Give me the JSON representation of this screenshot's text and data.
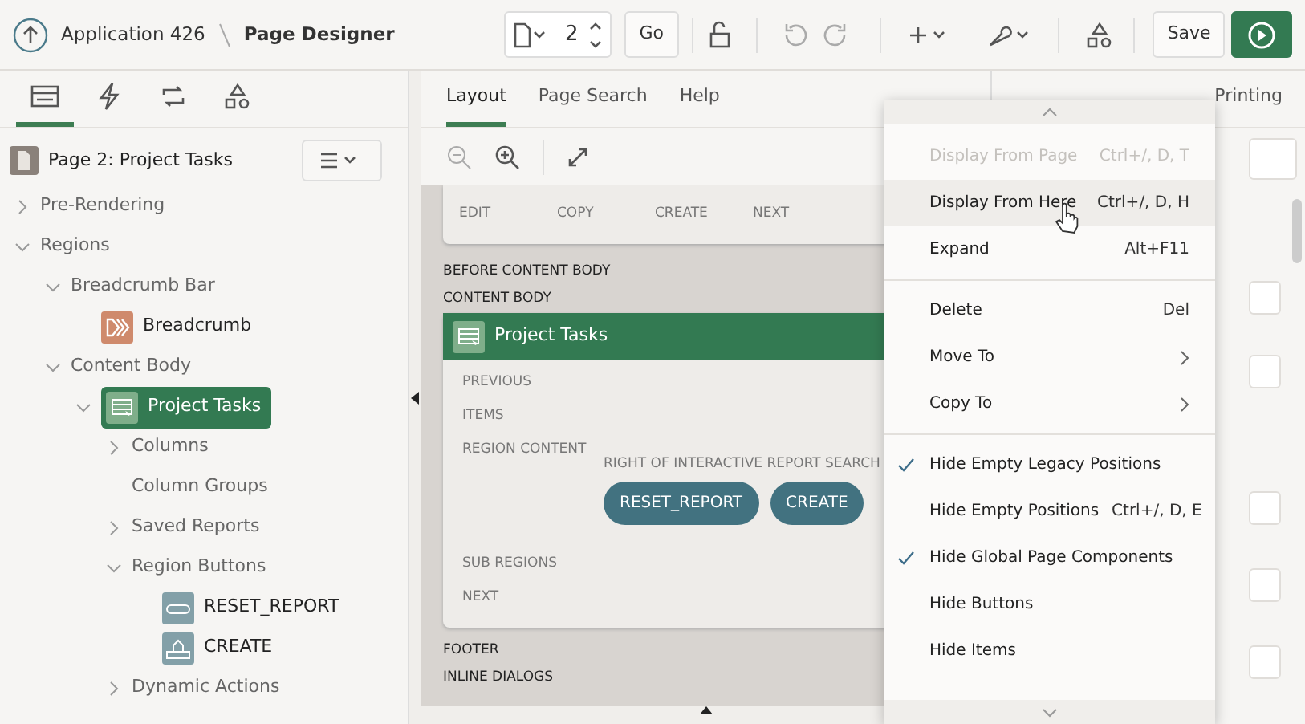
{
  "header": {
    "app_label": "Application 426",
    "page_label": "Page Designer",
    "page_number": "2",
    "go_button": "Go",
    "save_button": "Save"
  },
  "left_tabs": [
    {
      "kind": "tree",
      "selected": true
    },
    {
      "kind": "bolt",
      "selected": false
    },
    {
      "kind": "sync",
      "selected": false
    },
    {
      "kind": "shapes",
      "selected": false
    }
  ],
  "page_title": "Page 2: Project Tasks",
  "tree": [
    {
      "label": "Pre-Rendering",
      "expanded": false,
      "selected": false
    },
    {
      "label": "Regions",
      "expanded": true,
      "selected": false,
      "children": [
        {
          "label": "Breadcrumb Bar",
          "expanded": true,
          "selected": false,
          "children": [
            {
              "label": "Breadcrumb",
              "kind": "breadcrumb",
              "selected": false
            }
          ]
        },
        {
          "label": "Content Body",
          "expanded": true,
          "selected": false,
          "children": [
            {
              "label": "Project Tasks",
              "kind": "report",
              "expanded": true,
              "selected": true,
              "children": [
                {
                  "label": "Columns",
                  "expanded": false,
                  "selected": false
                },
                {
                  "label": "Column Groups",
                  "selected": false
                },
                {
                  "label": "Saved Reports",
                  "expanded": false,
                  "selected": false
                },
                {
                  "label": "Region Buttons",
                  "expanded": true,
                  "selected": false,
                  "children": [
                    {
                      "label": "RESET_REPORT",
                      "kind": "button",
                      "selected": false
                    },
                    {
                      "label": "CREATE",
                      "kind": "create",
                      "selected": false
                    }
                  ]
                },
                {
                  "label": "Dynamic Actions",
                  "expanded": false,
                  "selected": false
                }
              ]
            }
          ]
        }
      ]
    }
  ],
  "center_tabs": [
    {
      "label": "Layout",
      "selected": true
    },
    {
      "label": "Page Search",
      "selected": false
    },
    {
      "label": "Help",
      "selected": false
    }
  ],
  "layout": {
    "top_slots": [
      "EDIT",
      "COPY",
      "CREATE",
      "NEXT"
    ],
    "positions_before": [
      "BEFORE CONTENT BODY",
      "CONTENT BODY"
    ],
    "region": {
      "title": "Project Tasks",
      "slots": [
        "PREVIOUS",
        "ITEMS",
        "REGION CONTENT"
      ],
      "button_position": "RIGHT OF INTERACTIVE REPORT SEARCH",
      "buttons": [
        "RESET_REPORT",
        "CREATE"
      ],
      "slots_after": [
        "SUB REGIONS",
        "NEXT"
      ]
    },
    "positions_after": [
      "FOOTER",
      "INLINE DIALOGS"
    ]
  },
  "right_tabs": [
    {
      "label": "Printing",
      "selected": false
    }
  ],
  "context_menu": [
    {
      "kind": "item",
      "label": "Display From Page",
      "shortcut": "Ctrl+/, D, T",
      "disabled": true,
      "checked": false,
      "hovered": false
    },
    {
      "kind": "item",
      "label": "Display From Here",
      "shortcut": "Ctrl+/, D, H",
      "disabled": false,
      "checked": false,
      "hovered": true
    },
    {
      "kind": "item",
      "label": "Expand",
      "shortcut": "Alt+F11",
      "disabled": false,
      "checked": false,
      "hovered": false
    },
    {
      "kind": "separator"
    },
    {
      "kind": "item",
      "label": "Delete",
      "shortcut": "Del",
      "disabled": false,
      "checked": false,
      "hovered": false
    },
    {
      "kind": "submenu",
      "label": "Move To",
      "disabled": false,
      "checked": false,
      "hovered": false
    },
    {
      "kind": "submenu",
      "label": "Copy To",
      "disabled": false,
      "checked": false,
      "hovered": false
    },
    {
      "kind": "separator"
    },
    {
      "kind": "item",
      "label": "Hide Empty Legacy Positions",
      "disabled": false,
      "checked": true,
      "hovered": false
    },
    {
      "kind": "item",
      "label": "Hide Empty Positions",
      "shortcut": "Ctrl+/, D, E",
      "disabled": false,
      "checked": false,
      "hovered": false
    },
    {
      "kind": "item",
      "label": "Hide Global Page Components",
      "disabled": false,
      "checked": true,
      "hovered": false
    },
    {
      "kind": "item",
      "label": "Hide Buttons",
      "disabled": false,
      "checked": false,
      "hovered": false
    },
    {
      "kind": "item",
      "label": "Hide Items",
      "disabled": false,
      "checked": false,
      "hovered": false
    }
  ]
}
